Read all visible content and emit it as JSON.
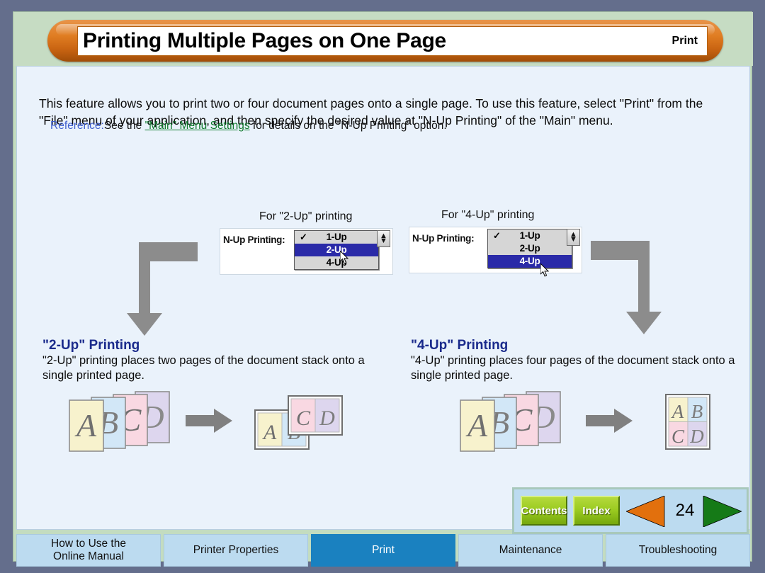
{
  "header": {
    "title": "Printing Multiple Pages on One Page",
    "section_label": "Print"
  },
  "intro": {
    "paragraph": "This feature allows you to print two or four document pages onto a single page. To use this feature, select \"Print\" from the \"File\" menu of your application, and then specify the desired value at \"N-Up Printing\" of the \"Main\" menu.",
    "reference_word": "Reference:",
    "reference_pre": "See the ",
    "reference_link": "\"Main\" Menu Settings",
    "reference_post": " for details on the \"N-Up Printing\" option."
  },
  "dropdowns": [
    {
      "caption": "For \"2-Up\" printing",
      "field_label": "N-Up Printing:",
      "options": [
        "1-Up",
        "2-Up",
        "4-Up"
      ],
      "checked": "1-Up",
      "selected": "2-Up",
      "check_glyph": "✓",
      "stepper_up": "▲",
      "stepper_down": "▼"
    },
    {
      "caption": "For \"4-Up\" printing",
      "field_label": "N-Up Printing:",
      "options": [
        "1-Up",
        "2-Up",
        "4-Up"
      ],
      "checked": "1-Up",
      "selected": "4-Up",
      "check_glyph": "✓",
      "stepper_up": "▲",
      "stepper_down": "▼"
    }
  ],
  "sections": [
    {
      "heading": "\"2-Up\" Printing",
      "body": "\"2-Up\" printing places two pages of the document stack onto a single printed page."
    },
    {
      "heading": "\"4-Up\" Printing",
      "body": "\"4-Up\" printing places four pages of the document stack onto a single printed page."
    }
  ],
  "illustration": {
    "page_letters": [
      "A",
      "B",
      "C",
      "D"
    ],
    "page_colors": [
      "#f7f2cd",
      "#d2e7f7",
      "#f9d8e2",
      "#ddd6ee"
    ],
    "arrow_color": "#808080"
  },
  "navbar": {
    "contents_label": "Contents",
    "index_label": "Index",
    "page_number": "24",
    "prev_color": "#e2700d",
    "next_color": "#157a17"
  },
  "tabs": [
    {
      "label": "How to Use the\nOnline Manual",
      "active": false
    },
    {
      "label": "Printer Properties",
      "active": false
    },
    {
      "label": "Print",
      "active": true
    },
    {
      "label": "Maintenance",
      "active": false
    },
    {
      "label": "Troubleshooting",
      "active": false
    }
  ],
  "colors": {
    "outer_frame": "#646e8c",
    "header_band": "#c6dcc3",
    "content_bg": "#eaf2fb",
    "title_pill": "#e07d22",
    "heading_blue": "#1a2a8c",
    "link_green": "#107a2d",
    "reference_blue": "#3f5fd0",
    "tab_active": "#1a81c0",
    "tab_inactive": "#bcdbf0",
    "menu_select": "#2a2aa8"
  }
}
